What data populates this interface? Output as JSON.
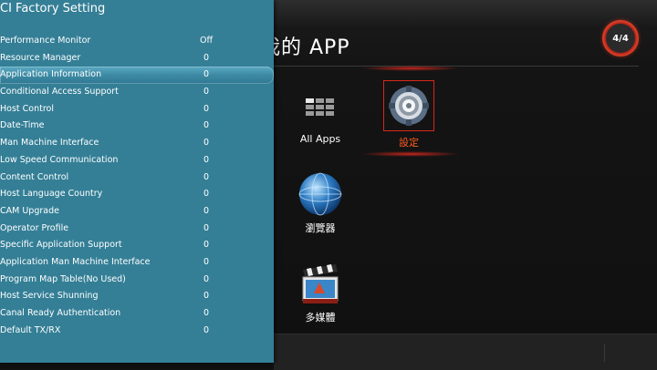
{
  "launcher": {
    "title": "我的 APP",
    "page_indicator": "4/4",
    "apps": [
      {
        "label": "All Apps",
        "icon": "grid-icon"
      },
      {
        "label": "設定",
        "icon": "gear-icon",
        "focused": true
      },
      {
        "label": "瀏覽器",
        "icon": "globe-icon"
      },
      {
        "label": "多媒體",
        "icon": "clapperboard-icon"
      }
    ],
    "colors": {
      "accent": "#d8261c",
      "focus_label": "#ff5a1e"
    }
  },
  "ci_panel": {
    "title": "CI Factory Setting",
    "background": "#347f96",
    "items": [
      {
        "name": "Performance Monitor",
        "value": "Off"
      },
      {
        "name": "Resource Manager",
        "value": "0"
      },
      {
        "name": "Application Information",
        "value": "0",
        "selected": true
      },
      {
        "name": "Conditional Access Support",
        "value": "0"
      },
      {
        "name": "Host Control",
        "value": "0"
      },
      {
        "name": "Date-Time",
        "value": "0"
      },
      {
        "name": "Man Machine Interface",
        "value": "0"
      },
      {
        "name": "Low Speed Communication",
        "value": "0"
      },
      {
        "name": "Content Control",
        "value": "0"
      },
      {
        "name": "Host Language Country",
        "value": "0"
      },
      {
        "name": "CAM Upgrade",
        "value": "0"
      },
      {
        "name": "Operator Profile",
        "value": "0"
      },
      {
        "name": "Specific Application Support",
        "value": "0"
      },
      {
        "name": "Application Man Machine Interface",
        "value": "0"
      },
      {
        "name": "Program Map Table(No Used)",
        "value": "0"
      },
      {
        "name": "Host Service Shunning",
        "value": "0"
      },
      {
        "name": "Canal Ready Authentication",
        "value": "0"
      },
      {
        "name": "Default TX/RX",
        "value": "0"
      }
    ]
  }
}
